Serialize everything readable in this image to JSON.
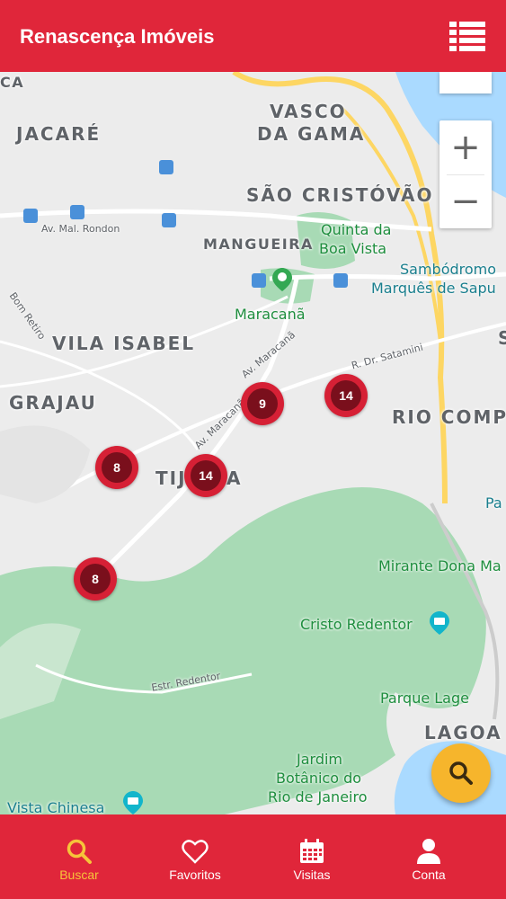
{
  "header": {
    "title": "Renascença Imóveis",
    "menu_icon": "list-icon"
  },
  "map": {
    "districts": {
      "vasco1": "VASCO",
      "vasco2": "DA GAMA",
      "jacare": "JACARÉ",
      "sao_cristovao": "SÃO CRISTÓVÃO",
      "mangueira": "MANGUEIRA",
      "vila_isabel": "VILA ISABEL",
      "grajau": "GRAJAU",
      "rio_comp": "RIO COMP",
      "tijuca_left": "TIJ",
      "tijuca_right": "A",
      "lagoa": "LAGOA",
      "top_left_fragment": "CA",
      "right_fragment": "S"
    },
    "pois": {
      "quinta1": "Quinta da",
      "quinta2": "Boa Vista",
      "sambodromo1": "Sambódromo",
      "sambodromo2": "Marquês de Sapu",
      "maracana": "Maracanã",
      "mirante": "Mirante Dona Ma",
      "cristo": "Cristo Redentor",
      "parque_lage": "Parque Lage",
      "jardim1": "Jardim",
      "jardim2": "Botânico do",
      "jardim3": "Rio de Janeiro",
      "vista_chinesa": "Vista Chinesa",
      "pa_fragment": "Pa"
    },
    "streets": {
      "mal_rondon": "Av. Mal. Rondon",
      "maracana_av1": "Av. Maracanã",
      "maracana_av2": "Av. Maracanã",
      "satamini": "R. Dr. Satamini",
      "redentor": "Estr. Redentor",
      "bom_retiro": "Bom Retiro"
    },
    "zoom_in": "+",
    "zoom_out": "−",
    "clusters": [
      {
        "count": "9"
      },
      {
        "count": "14"
      },
      {
        "count": "8"
      },
      {
        "count": "14"
      },
      {
        "count": "8"
      }
    ],
    "colors": {
      "park": "#a8dab5",
      "land": "#ececec",
      "water": "#aadaff",
      "highway": "#fdd663",
      "cluster_outer": "#d62035",
      "cluster_inner": "#7a0f1c"
    }
  },
  "fab": {
    "icon": "search-icon",
    "color": "#f6b52c"
  },
  "tabbar": {
    "color": "#e0263a",
    "tabs": [
      {
        "label": "Buscar",
        "icon": "search-icon",
        "active": true
      },
      {
        "label": "Favoritos",
        "icon": "heart-icon",
        "active": false
      },
      {
        "label": "Visitas",
        "icon": "calendar-icon",
        "active": false
      },
      {
        "label": "Conta",
        "icon": "user-icon",
        "active": false
      }
    ]
  }
}
